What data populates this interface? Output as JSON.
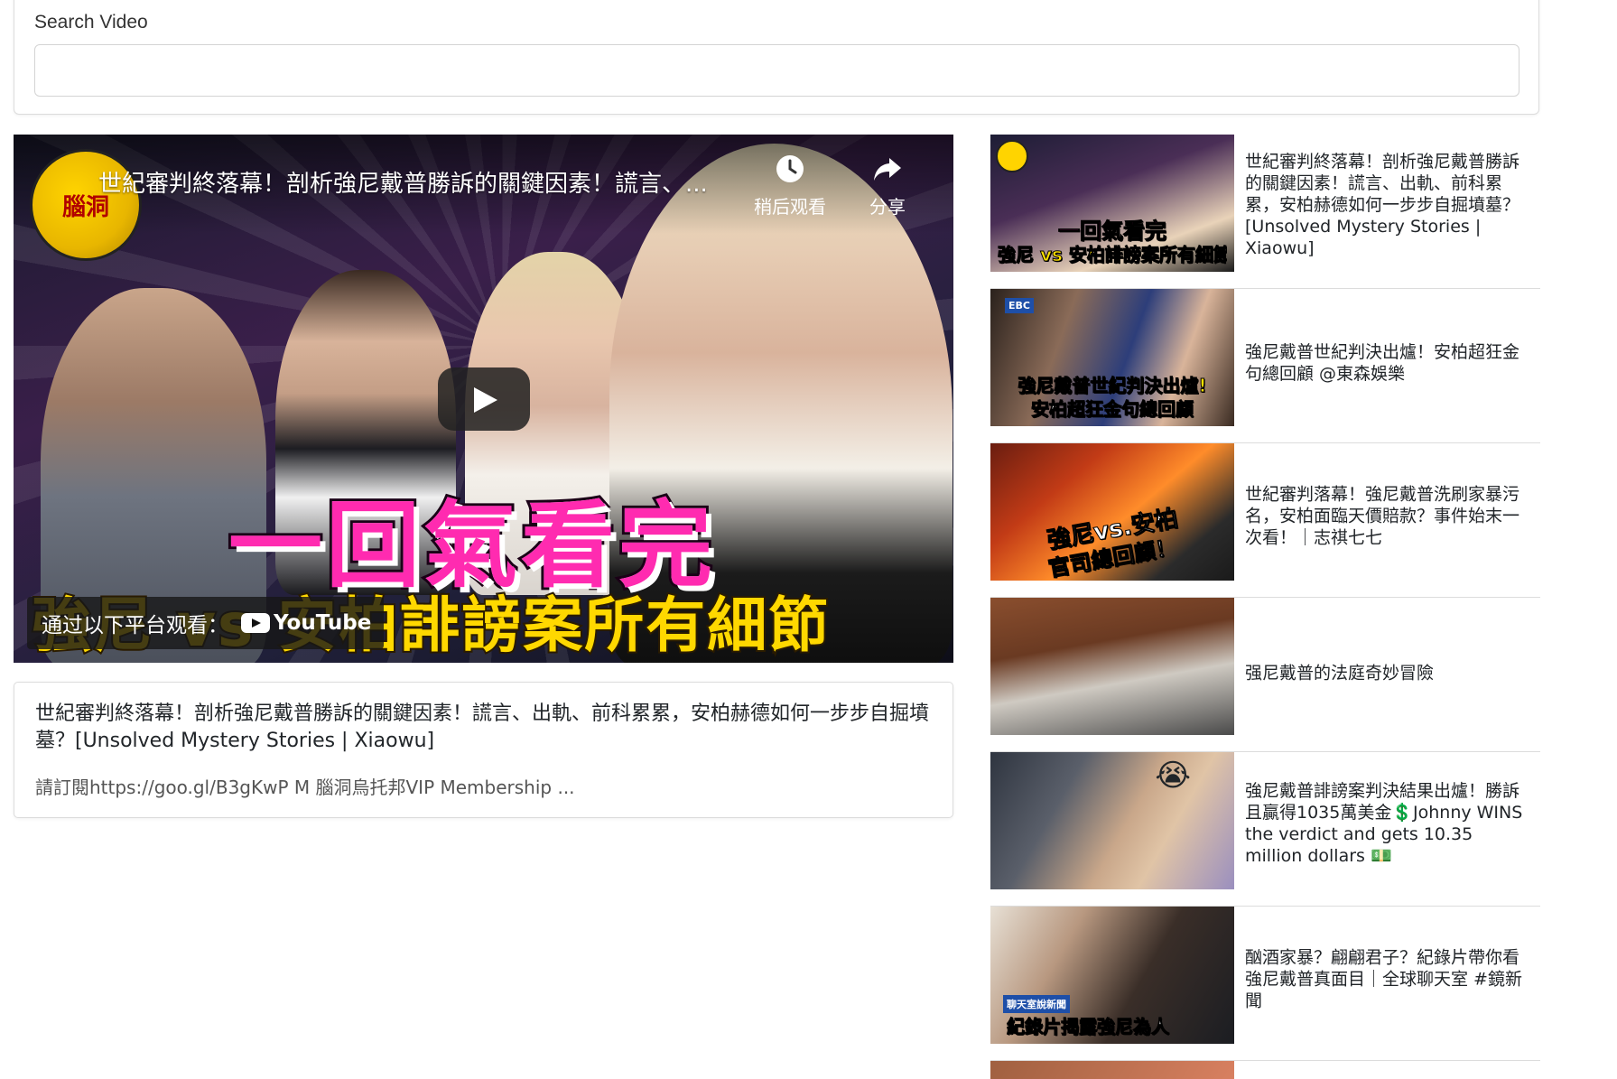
{
  "search": {
    "label": "Search Video",
    "value": "",
    "placeholder": ""
  },
  "player": {
    "title_overlay": "世紀審判終落幕！剖析強尼戴普勝訴的關鍵因素！謊言、...",
    "watch_later_label": "稍后观看",
    "share_label": "分享",
    "caption_main": "一回氣看完",
    "caption_sub": "強尼 vs 安柏誹謗案所有細節",
    "watch_on_label": "通过以下平台观看：",
    "youtube_label": "YouTube",
    "channel_logo_text": "腦洞"
  },
  "video_info": {
    "title": "世紀審判終落幕！剖析強尼戴普勝訴的關鍵因素！謊言、出軌、前科累累，安柏赫德如何一步步自掘墳墓？[Unsolved Mystery Stories | Xiaowu]",
    "description": "請訂閱https://goo.gl/B3gKwP M 腦洞烏托邦VIP Membership ..."
  },
  "related": [
    {
      "title": "世紀審判終落幕！剖析強尼戴普勝訴的關鍵因素！謊言、出軌、前科累累，安柏赫德如何一步步自掘墳墓？[Unsolved Mystery Stories | Xiaowu]",
      "thumb_caption_a": "一回氣看完",
      "thumb_caption_b": "強尼 vs 安柏誹謗案所有細節"
    },
    {
      "title": "強尼戴普世紀判決出爐！安柏超狂金句總回顧 @東森娛樂",
      "thumb_caption_a": "強尼戴普世紀判決出爐!",
      "thumb_caption_b": "安柏超狂金句總回顧"
    },
    {
      "title": "世紀審判落幕！強尼戴普洗刷家暴污名，安柏面臨天價賠款？事件始末一次看！｜志祺七七",
      "thumb_caption_a": "強尼vs.安柏",
      "thumb_caption_b": "官司總回顧！"
    },
    {
      "title": "强尼戴普的法庭奇妙冒險",
      "thumb_caption_a": "",
      "thumb_caption_b": ""
    },
    {
      "title": "強尼戴普誹謗案判決結果出爐！勝訴且贏得1035萬美金💲Johnny WINS the verdict and gets 10.35 million dollars 💵",
      "thumb_caption_a": "",
      "thumb_caption_b": ""
    },
    {
      "title": "酗酒家暴？翩翩君子？紀錄片帶你看強尼戴普真面目｜全球聊天室 #鏡新聞",
      "thumb_caption_a": "聊天室說新聞",
      "thumb_caption_b": "紀錄片揭露強尼為人"
    }
  ]
}
